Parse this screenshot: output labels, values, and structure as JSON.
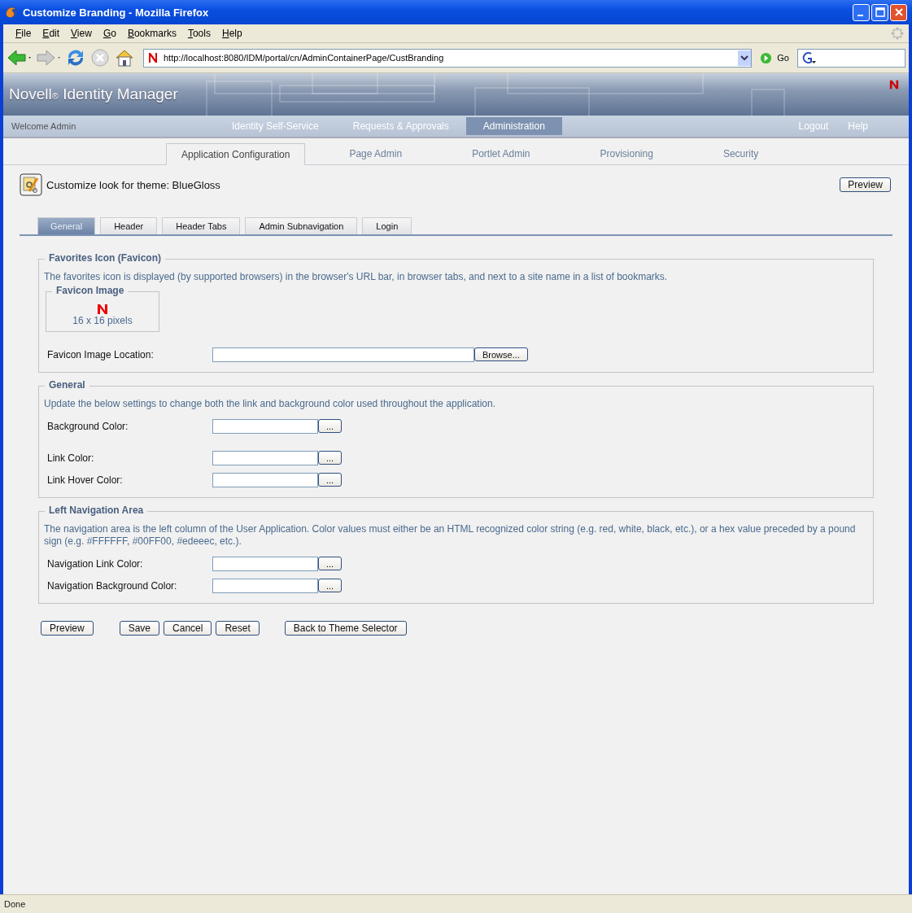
{
  "window": {
    "title": "Customize Branding - Mozilla Firefox"
  },
  "menu": [
    "File",
    "Edit",
    "View",
    "Go",
    "Bookmarks",
    "Tools",
    "Help"
  ],
  "toolbar": {
    "url": "http://localhost:8080/IDM/portal/cn/AdminContainerPage/CustBranding",
    "go": "Go"
  },
  "header": {
    "brand": "Novell",
    "reg": "®",
    "product": "Identity Manager"
  },
  "topnav": {
    "welcome": "Welcome Admin",
    "items": [
      {
        "label": "Identity Self-Service",
        "selected": false
      },
      {
        "label": "Requests & Approvals",
        "selected": false
      },
      {
        "label": "Administration",
        "selected": true
      }
    ],
    "links": [
      "Logout",
      "Help"
    ]
  },
  "subnav": [
    {
      "label": "Application Configuration",
      "selected": true
    },
    {
      "label": "Page Admin",
      "selected": false
    },
    {
      "label": "Portlet Admin",
      "selected": false
    },
    {
      "label": "Provisioning",
      "selected": false
    },
    {
      "label": "Security",
      "selected": false
    }
  ],
  "page": {
    "title": "Customize look for theme: BlueGloss",
    "preview": "Preview"
  },
  "tabs": [
    {
      "label": "General",
      "selected": true
    },
    {
      "label": "Header",
      "selected": false
    },
    {
      "label": "Header Tabs",
      "selected": false
    },
    {
      "label": "Admin Subnavigation",
      "selected": false
    },
    {
      "label": "Login",
      "selected": false
    }
  ],
  "sections": [
    {
      "legend": "Favorites Icon (Favicon)",
      "description": "The favorites icon is displayed (by supported browsers) in the browser's URL bar, in browser tabs, and next to a site name in a list of bookmarks.",
      "favicon": {
        "legend": "Favicon Image",
        "caption": "16 x 16 pixels"
      },
      "fields": [
        {
          "label": "Favicon Image Location:",
          "kind": "file",
          "button": "Browse..."
        }
      ]
    },
    {
      "legend": "General",
      "description": "Update the below settings to change both the link and background color used throughout the application.",
      "fields": [
        {
          "label": "Background Color:",
          "kind": "color",
          "button": "..."
        },
        {
          "label": "Link Color:",
          "kind": "color",
          "button": "..."
        },
        {
          "label": "Link Hover Color:",
          "kind": "color",
          "button": "..."
        }
      ]
    },
    {
      "legend": "Left Navigation Area",
      "description": "The navigation area is the left column of the User Application. Color values must either be an HTML recognized color string (e.g. red, white, black, etc.), or a hex value preceded by a pound sign (e.g. #FFFFFF, #00FF00, #edeeec, etc.).",
      "fields": [
        {
          "label": "Navigation Link Color:",
          "kind": "color",
          "button": "..."
        },
        {
          "label": "Navigation Background Color:",
          "kind": "color",
          "button": "..."
        }
      ]
    }
  ],
  "buttons": [
    "Preview",
    "Save",
    "Cancel",
    "Reset",
    "Back to Theme Selector"
  ],
  "status_bar": "Done"
}
